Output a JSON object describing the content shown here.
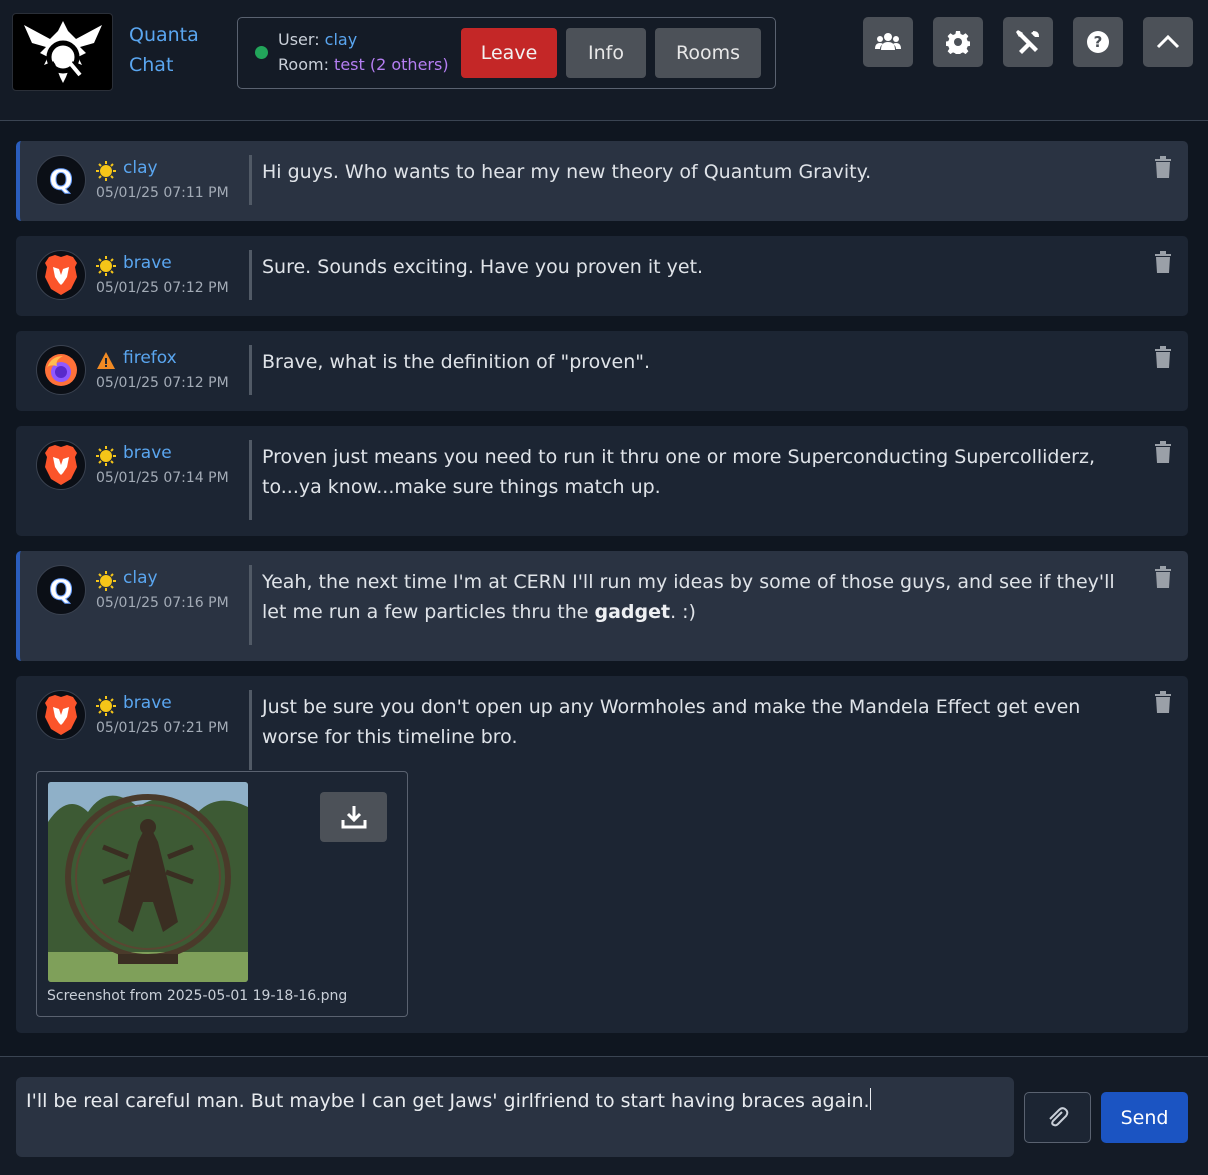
{
  "app": {
    "brand_line1": "Quanta",
    "brand_line2": "Chat"
  },
  "status": {
    "user_label": "User:",
    "user_value": "clay",
    "room_label": "Room:",
    "room_value": "test (2 others)",
    "online_color": "#22a55a"
  },
  "header_buttons": {
    "leave": "Leave",
    "info": "Info",
    "rooms": "Rooms"
  },
  "toolbar_icons": [
    "users-icon",
    "gear-icon",
    "tools-icon",
    "help-icon",
    "chevron-up-icon"
  ],
  "messages": [
    {
      "user": "clay",
      "timestamp": "05/01/25 07:11 PM",
      "status_icon": "sun-icon",
      "avatar": "quanta-avatar",
      "text": "Hi guys. Who wants to hear my new theory of Quantum Gravity.",
      "self": true
    },
    {
      "user": "brave",
      "timestamp": "05/01/25 07:12 PM",
      "status_icon": "sun-icon",
      "avatar": "brave-avatar",
      "text": "Sure. Sounds exciting. Have you proven it yet.",
      "self": false
    },
    {
      "user": "firefox",
      "timestamp": "05/01/25 07:12 PM",
      "status_icon": "warning-icon",
      "avatar": "firefox-avatar",
      "text": "Brave, what is the definition of \"proven\".",
      "self": false
    },
    {
      "user": "brave",
      "timestamp": "05/01/25 07:14 PM",
      "status_icon": "sun-icon",
      "avatar": "brave-avatar",
      "text": "Proven just means you need to run it thru one or more Superconducting Supercolliderz, to...ya know...make sure things match up.",
      "self": false
    },
    {
      "user": "clay",
      "timestamp": "05/01/25 07:16 PM",
      "status_icon": "sun-icon",
      "avatar": "quanta-avatar",
      "text_before": "Yeah, the next time I'm at CERN I'll run my ideas by some of those guys, and see if they'll let me run a few particles thru the ",
      "text_bold": "gadget",
      "text_after": ". :)",
      "self": true
    },
    {
      "user": "brave",
      "timestamp": "05/01/25 07:21 PM",
      "status_icon": "sun-icon",
      "avatar": "brave-avatar",
      "text": "Just be sure you don't open up any Wormholes and make the Mandela Effect get even worse for this timeline bro.",
      "self": false,
      "attachment": {
        "filename": "Screenshot from 2025-05-01 19-18-16.png",
        "icon": "download-icon"
      }
    }
  ],
  "composer": {
    "value": "I'll be real careful man. But maybe I can get Jaws' girlfriend to start having braces again.",
    "send_label": "Send",
    "attach_icon": "paperclip-icon"
  },
  "colors": {
    "accent": "#5aa6f0",
    "room": "#b57ef2",
    "leave": "#c42727",
    "send": "#1b54c2",
    "self_border": "#2a5dbd"
  }
}
